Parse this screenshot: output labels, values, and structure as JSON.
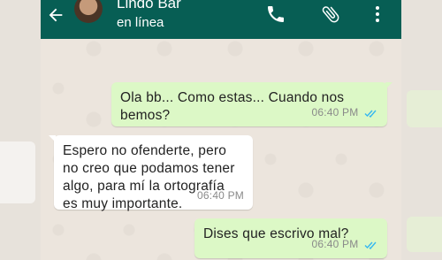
{
  "header": {
    "contact_name": "Lindo Bar",
    "status": "en línea",
    "icons": [
      "back-arrow-icon",
      "phone-icon",
      "paperclip-icon",
      "more-vertical-icon"
    ]
  },
  "messages": [
    {
      "direction": "out",
      "text": "Ola bb... Como estas... Cuando nos\nbemos?",
      "time": "06:40 PM",
      "read": true
    },
    {
      "direction": "in",
      "text": "Espero no ofenderte, pero\nno creo que podamos tener\nalgo, para mí la ortografía\nes muy importante.",
      "time": "06:40 PM"
    },
    {
      "direction": "out",
      "text": "Dises que escrivo mal?",
      "time": "06:40 PM",
      "read": true
    }
  ],
  "colors": {
    "header": "#075e54",
    "outgoing_bubble": "#dcf8c6",
    "incoming_bubble": "#ffffff",
    "read_ticks": "#34b7f1"
  }
}
